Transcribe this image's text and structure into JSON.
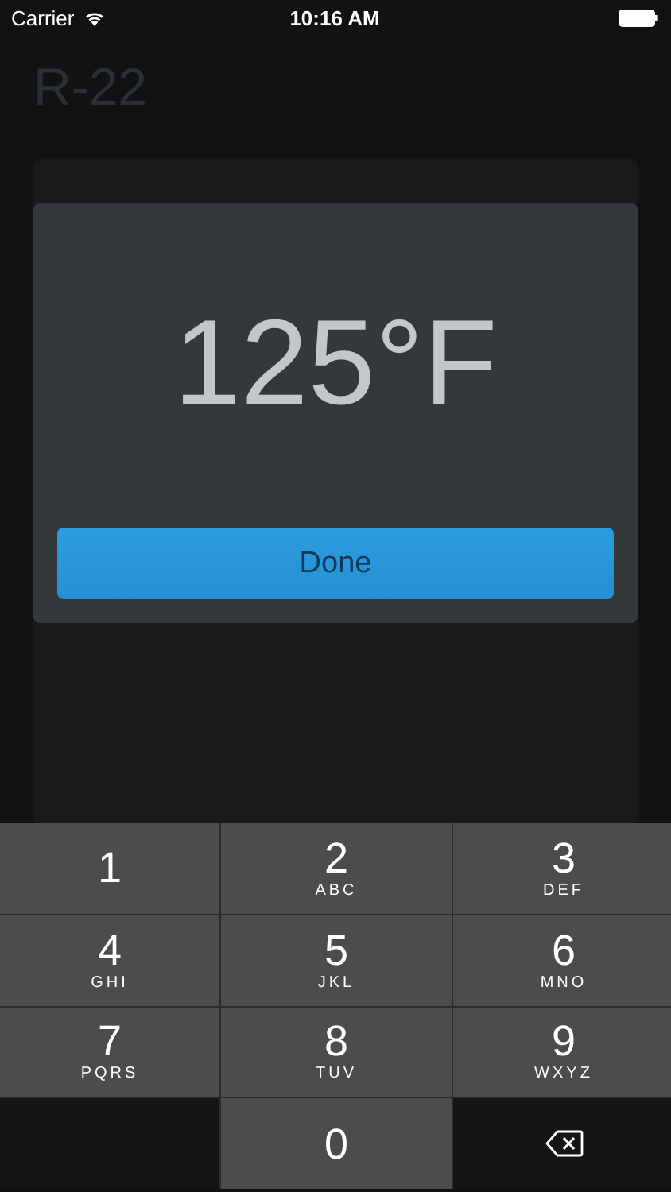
{
  "status_bar": {
    "carrier": "Carrier",
    "time": "10:16 AM"
  },
  "title": "R-22",
  "dialog": {
    "reading": "125°F",
    "button": "Done"
  },
  "keypad": [
    {
      "kind": "digit",
      "digit": "1"
    },
    {
      "kind": "digit",
      "digit": "2",
      "letters": "ABC"
    },
    {
      "kind": "digit",
      "digit": "3",
      "letters": "DEF"
    },
    {
      "kind": "digit",
      "digit": "4",
      "letters": "GHI"
    },
    {
      "kind": "digit",
      "digit": "5",
      "letters": "JKL"
    },
    {
      "kind": "digit",
      "digit": "6",
      "letters": "MNO"
    },
    {
      "kind": "digit",
      "digit": "7",
      "letters": "PQRS"
    },
    {
      "kind": "digit",
      "digit": "8",
      "letters": "TUV"
    },
    {
      "kind": "digit",
      "digit": "9",
      "letters": "WXYZ"
    },
    {
      "kind": "blank"
    },
    {
      "kind": "digit",
      "digit": "0"
    },
    {
      "kind": "delete"
    }
  ]
}
